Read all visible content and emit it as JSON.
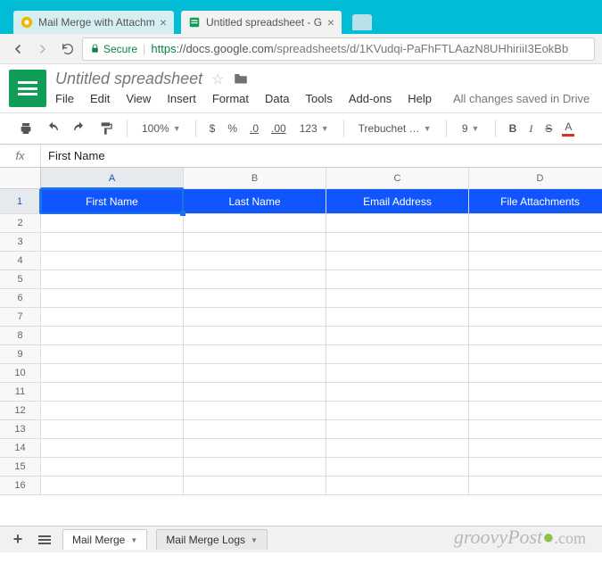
{
  "browser": {
    "tabs": [
      {
        "title": "Mail Merge with Attachm",
        "active": false
      },
      {
        "title": "Untitled spreadsheet - G",
        "active": true
      }
    ],
    "secure_label": "Secure",
    "url_proto": "https",
    "url_host": "://docs.google.com",
    "url_path": "/spreadsheets/d/1KVudqi-PaFhFTLAazN8UHhiriiI3EokBb"
  },
  "doc": {
    "title": "Untitled spreadsheet",
    "menus": [
      "File",
      "Edit",
      "View",
      "Insert",
      "Format",
      "Data",
      "Tools",
      "Add-ons",
      "Help"
    ],
    "saved": "All changes saved in Drive"
  },
  "toolbar": {
    "zoom": "100%",
    "currency": "$",
    "percent": "%",
    "dec_less": ".0",
    "dec_more": ".00",
    "num_fmt": "123",
    "font": "Trebuchet …",
    "size": "9",
    "bold": "B",
    "italic": "I",
    "strike": "S",
    "textcolor": "A"
  },
  "formula": {
    "fx": "fx",
    "value": "First Name"
  },
  "grid": {
    "cols": [
      "A",
      "B",
      "C",
      "D"
    ],
    "headers": [
      "First Name",
      "Last Name",
      "Email Address",
      "File Attachments"
    ],
    "row_count": 16,
    "selected_col": 0,
    "selected_row": 1
  },
  "sheets": {
    "tabs": [
      {
        "name": "Mail Merge",
        "active": true
      },
      {
        "name": "Mail Merge Logs",
        "active": false
      }
    ]
  },
  "watermark": {
    "text": "groovyPost",
    "suffix": ".com"
  }
}
